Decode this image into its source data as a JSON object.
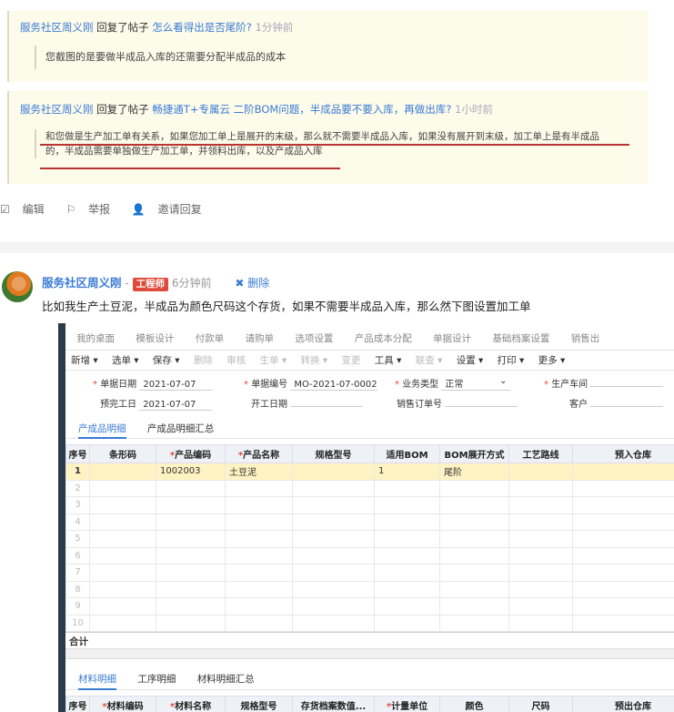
{
  "reply1": {
    "user": "服务社区周义刚",
    "action": "回复了帖子",
    "post_title": "怎么看得出是否尾阶?",
    "time": "1分钟前",
    "content": "您截图的是要做半成品入库的还需要分配半成品的成本"
  },
  "reply2": {
    "user": "服务社区周义刚",
    "action": "回复了帖子",
    "post_title": "畅捷通T+专属云 二阶BOM问题，半成品要不要入库，再做出库?",
    "time": "1小时前",
    "content_line1": "和您做是生产加工单有关系，如果您加工单上是展开的末级，那么就不需要半成品入库，如果没有展开到末级，加工单上是有半成品",
    "content_line2": "的，半成品需要单独做生产加工单，并领料出库，以及产成品入库"
  },
  "actions": {
    "edit": "编辑",
    "report": "举报",
    "invite": "邀请回复"
  },
  "post": {
    "author": "服务社区周义刚",
    "sep": "-",
    "badge": "工程师",
    "time": "6分钟前",
    "delete": "删除",
    "text": "比如我生产土豆泥，半成品为颜色尺码这个存货，如果不需要半成品入库，那么然下图设置加工单"
  },
  "shot": {
    "top_tabs": [
      "我的桌面",
      "模板设计",
      "付款单",
      "请购单",
      "选项设置",
      "产品成本分配",
      "单据设计",
      "基础档案设置",
      "销售出"
    ],
    "toolbar": [
      "新增 ▾",
      "选单 ▾",
      "保存 ▾",
      "删除",
      "审核",
      "生单 ▾",
      "转换 ▾",
      "变更",
      "工具 ▾",
      "联查 ▾",
      "设置 ▾",
      "打印 ▾",
      "更多 ▾"
    ],
    "form": {
      "date_label": "单据日期",
      "date_value": "2021-07-07",
      "code_label": "单据编号",
      "code_value": "MO-2021-07-0002",
      "type_label": "业务类型",
      "type_value": "正常",
      "workshop_label": "生产车间",
      "finish_label": "预完工日",
      "finish_value": "2021-07-07",
      "start_label": "开工日期",
      "order_label": "销售订单号",
      "customer_label": "客户"
    },
    "tabs": [
      "产成品明细",
      "产成品明细汇总"
    ],
    "columns": [
      "序号",
      "条形码",
      "产品编码",
      "产品名称",
      "规格型号",
      "适用BOM",
      "BOM展开方式",
      "工艺路线",
      "预入仓库"
    ],
    "row1": {
      "num": "1",
      "barcode": "",
      "code": "1002003",
      "name": "土豆泥",
      "spec": "",
      "bom": "1",
      "expand": "尾阶",
      "route": "",
      "warehouse": ""
    },
    "row_nums": [
      "2",
      "3",
      "4",
      "5",
      "6",
      "7",
      "8",
      "9",
      "10"
    ],
    "sum_label": "合计",
    "tabs2": [
      "材料明细",
      "工序明细",
      "材料明细汇总"
    ],
    "columns2": [
      "序号",
      "材料编码",
      "材料名称",
      "规格型号",
      "存货档案数值...",
      "计量单位",
      "颜色",
      "尺码",
      "预出仓库"
    ]
  }
}
